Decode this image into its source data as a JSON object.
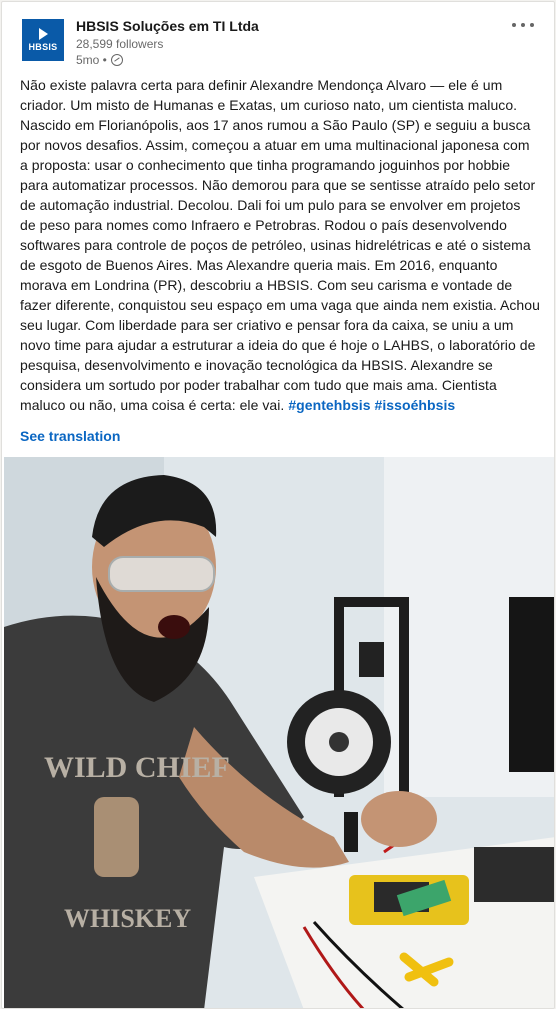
{
  "post": {
    "author": "HBSIS Soluções em TI Ltda",
    "followers": "28,599 followers",
    "time": "5mo •",
    "logo_text": "HBSIS",
    "body": "Não existe palavra certa para definir Alexandre Mendonça Alvaro — ele é um criador. Um misto de Humanas e Exatas, um curioso nato, um cientista maluco. Nascido em Florianópolis, aos 17 anos rumou a São Paulo (SP) e seguiu a busca por novos desafios. Assim, começou a atuar em uma multinacional japonesa com a proposta: usar o conhecimento que tinha programando joguinhos por hobbie para automatizar processos. Não demorou para que se sentisse atraído pelo setor de automação industrial. Decolou. Dali foi um pulo para se envolver em projetos de peso para nomes como Infraero e Petrobras. Rodou o país desenvolvendo softwares para controle de poços de petróleo, usinas hidrelétricas e até o sistema de esgoto de Buenos Aires. Mas Alexandre queria mais. Em 2016, enquanto morava em Londrina (PR), descobriu a HBSIS. Com seu carisma e vontade de fazer diferente, conquistou seu espaço em uma vaga que ainda nem existia. Achou seu lugar. Com liberdade para ser criativo e pensar fora da caixa, se uniu a um novo time para ajudar a estruturar a ideia do que é hoje o LAHBS, o laboratório de pesquisa, desenvolvimento e inovação tecnológica da HBSIS. Alexandre se considera um sortudo por poder trabalhar com tudo que mais ama. Cientista maluco ou não, uma coisa é certa: ele vai.",
    "hashtags": [
      "#gentehbsis",
      "#issoéhbsis"
    ],
    "see_translation": "See translation"
  },
  "icons": {
    "more": "more-options-icon",
    "visibility": "globe-icon"
  },
  "colors": {
    "link": "#0a66c2",
    "logo_bg": "#0a5aa8"
  }
}
